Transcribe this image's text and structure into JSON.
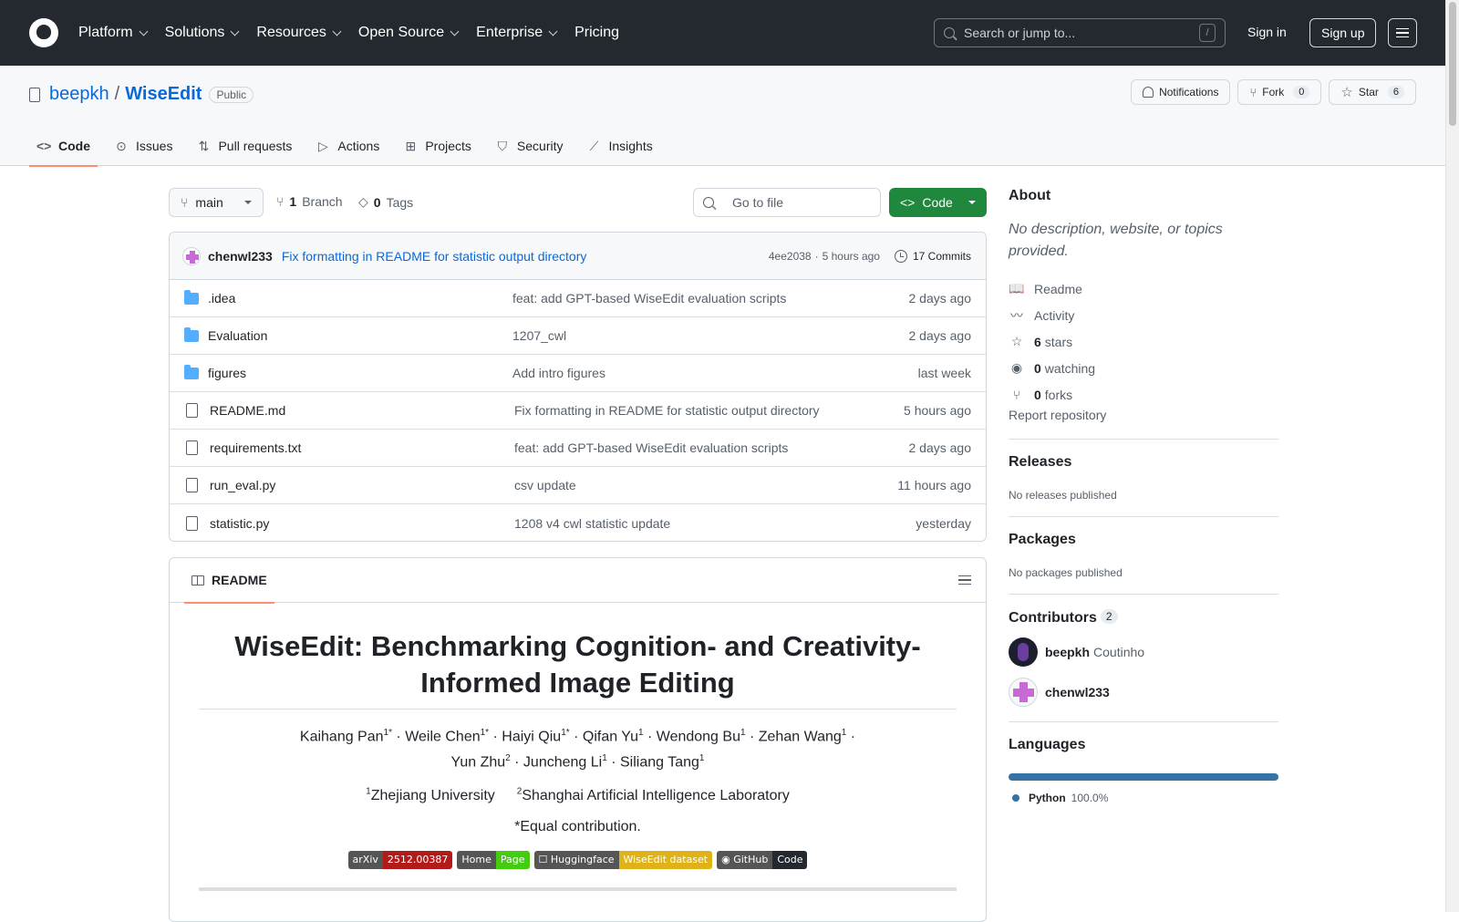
{
  "header": {
    "nav": [
      "Platform",
      "Solutions",
      "Resources",
      "Open Source",
      "Enterprise",
      "Pricing"
    ],
    "search_placeholder": "Search or jump to...",
    "search_key": "/",
    "sign_in": "Sign in",
    "sign_up": "Sign up"
  },
  "repo": {
    "owner": "beepkh",
    "separator": "/",
    "name": "WiseEdit",
    "visibility": "Public",
    "notifications": "Notifications",
    "fork_label": "Fork",
    "fork_count": "0",
    "star_label": "Star",
    "star_count": "6"
  },
  "tabs": [
    {
      "label": "Code",
      "icon": "<>"
    },
    {
      "label": "Issues",
      "icon": "⊙"
    },
    {
      "label": "Pull requests",
      "icon": "⇅"
    },
    {
      "label": "Actions",
      "icon": "▷"
    },
    {
      "label": "Projects",
      "icon": "⊞"
    },
    {
      "label": "Security",
      "icon": "⛉"
    },
    {
      "label": "Insights",
      "icon": "⟋"
    }
  ],
  "branch": {
    "name": "main",
    "branch_count": "1",
    "branch_label": "Branch",
    "tag_count": "0",
    "tag_label": "Tags",
    "goto_placeholder": "Go to file",
    "code_button": "Code"
  },
  "last_commit": {
    "author": "chenwl233",
    "message": "Fix formatting in README for statistic output directory",
    "hash": "4ee2038",
    "dot": "·",
    "time": "5 hours ago",
    "commits": "17 Commits"
  },
  "files": [
    {
      "name": ".idea",
      "type": "folder",
      "message": "feat: add GPT-based WiseEdit evaluation scripts",
      "date": "2 days ago"
    },
    {
      "name": "Evaluation",
      "type": "folder",
      "message": "1207_cwl",
      "date": "2 days ago"
    },
    {
      "name": "figures",
      "type": "folder",
      "message": "Add intro figures",
      "date": "last week"
    },
    {
      "name": "README.md",
      "type": "file",
      "message": "Fix formatting in README for statistic output directory",
      "date": "5 hours ago"
    },
    {
      "name": "requirements.txt",
      "type": "file",
      "message": "feat: add GPT-based WiseEdit evaluation scripts",
      "date": "2 days ago"
    },
    {
      "name": "run_eval.py",
      "type": "file",
      "message": "csv update",
      "date": "11 hours ago"
    },
    {
      "name": "statistic.py",
      "type": "file",
      "message": "1208 v4 cwl statistic update",
      "date": "yesterday"
    }
  ],
  "readme": {
    "tab": "README",
    "title": "WiseEdit: Benchmarking Cognition- and Creativity-Informed Image Editing",
    "authors_line1": [
      {
        "name": "Kaihang Pan",
        "sup": "1*"
      },
      {
        "name": "Weile Chen",
        "sup": "1*"
      },
      {
        "name": "Haiyi Qiu",
        "sup": "1*"
      },
      {
        "name": "Qifan Yu",
        "sup": "1"
      },
      {
        "name": "Wendong Bu",
        "sup": "1"
      },
      {
        "name": "Zehan Wang",
        "sup": "1"
      }
    ],
    "authors_line2": [
      {
        "name": "Yun Zhu",
        "sup": "2"
      },
      {
        "name": "Juncheng Li",
        "sup": "1"
      },
      {
        "name": "Siliang Tang",
        "sup": "1"
      }
    ],
    "affiliations": [
      {
        "sup": "1",
        "name": "Zhejiang University"
      },
      {
        "sup": "2",
        "name": "Shanghai Artificial Intelligence Laboratory"
      }
    ],
    "equal": "*Equal contribution.",
    "badges": [
      {
        "left": "arXiv",
        "right": "2512.00387",
        "color": "#b31b1b"
      },
      {
        "left": "Home",
        "right": "Page",
        "color": "#4c1"
      },
      {
        "left": "☐ Huggingface",
        "right": "WiseEdit dataset",
        "color": "#dfb317"
      },
      {
        "left": "◉ GitHub",
        "right": "Code",
        "color": "#24292f"
      }
    ]
  },
  "sidebar": {
    "about_title": "About",
    "about_desc": "No description, website, or topics provided.",
    "links": [
      {
        "icon": "book-icon",
        "glyph": "📖",
        "bold": "",
        "text": "Readme"
      },
      {
        "icon": "pulse-icon",
        "glyph": "〰",
        "bold": "",
        "text": "Activity"
      },
      {
        "icon": "star-icon",
        "glyph": "☆",
        "bold": "6",
        "text": "stars"
      },
      {
        "icon": "eye-icon",
        "glyph": "◉",
        "bold": "0",
        "text": "watching"
      },
      {
        "icon": "fork-icon",
        "glyph": "⑂",
        "bold": "0",
        "text": "forks"
      }
    ],
    "report": "Report repository",
    "releases_title": "Releases",
    "releases_text": "No releases published",
    "packages_title": "Packages",
    "packages_text": "No packages published",
    "contributors_title": "Contributors",
    "contributors_count": "2",
    "contributors": [
      {
        "login": "beepkh",
        "name": "Coutinho"
      },
      {
        "login": "chenwl233",
        "name": ""
      }
    ],
    "languages_title": "Languages",
    "languages": [
      {
        "name": "Python",
        "percent": "100.0%",
        "color": "#3572a5"
      }
    ]
  }
}
